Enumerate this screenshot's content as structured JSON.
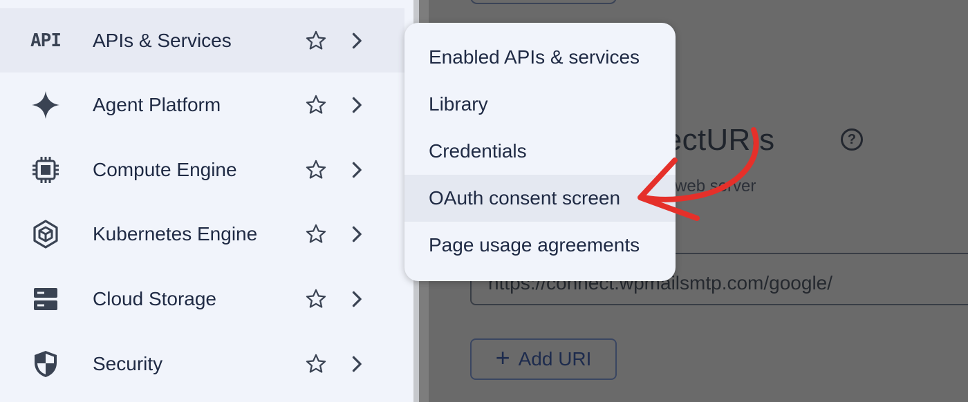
{
  "background_page": {
    "section_title": "directURIs",
    "subtitle": "a web server",
    "uri_field_value": "https://connect.wpmailsmtp.com/google/",
    "add_uri_label": "Add URI",
    "add_uri_icon": "plus-icon",
    "help_icon": "help-circle-icon",
    "help_symbol": "?"
  },
  "sidebar": {
    "items": [
      {
        "label": "APIs & Services",
        "icon": "api-icon",
        "icon_text": "API",
        "active": true
      },
      {
        "label": "Agent Platform",
        "icon": "sparkle-icon",
        "active": false
      },
      {
        "label": "Compute Engine",
        "icon": "chip-icon",
        "active": false
      },
      {
        "label": "Kubernetes Engine",
        "icon": "kubernetes-icon",
        "active": false
      },
      {
        "label": "Cloud Storage",
        "icon": "storage-icon",
        "active": false
      },
      {
        "label": "Security",
        "icon": "shield-icon",
        "active": false
      }
    ],
    "pin_icon": "star-outline-icon",
    "expand_icon": "chevron-right-icon"
  },
  "submenu": {
    "items": [
      {
        "label": "Enabled APIs & services",
        "highlighted": false
      },
      {
        "label": "Library",
        "highlighted": false
      },
      {
        "label": "Credentials",
        "highlighted": false
      },
      {
        "label": "OAuth consent screen",
        "highlighted": true
      },
      {
        "label": "Page usage agreements",
        "highlighted": false
      }
    ]
  },
  "annotation": {
    "icon": "red-arrow-annotation",
    "color": "#e5302a"
  },
  "colors": {
    "sidebar_bg": "#f1f4fb",
    "active_item_bg": "#e7eaf3",
    "text": "#1f2a44",
    "overlay_bg": "#6a6a6a",
    "accent_red": "#e5302a"
  }
}
